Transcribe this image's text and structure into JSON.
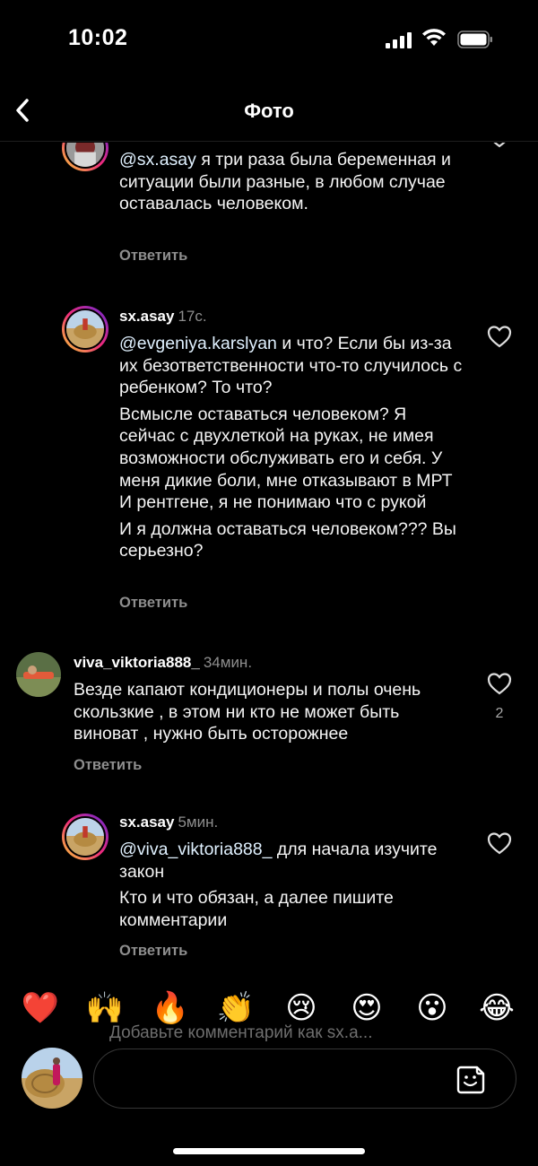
{
  "status_bar": {
    "time": "10:02"
  },
  "nav": {
    "title": "Фото",
    "back_icon": "chevron-left-icon"
  },
  "comments": [
    {
      "user": "",
      "time": "",
      "mention": "@sx.asay",
      "paragraphs": [
        "я три раза была беременная и ситуации были разные, в любом случае оставалась человеком."
      ],
      "reply_label": "Ответить",
      "likes": ""
    },
    {
      "user": "sx.asay",
      "time": "17с.",
      "mention": "@evgeniya.karslyan",
      "paragraphs": [
        "и что? Если бы из-за их безответственности что-то случилось с ребенком? То что?",
        "Всмысле оставаться человеком? Я сейчас с двухлеткой на руках, не имея возможности обслуживать его и себя. У меня дикие боли, мне отказывают в МРТ И рентгене, я не понимаю что с рукой",
        "И я должна оставаться человеком??? Вы серьезно?"
      ],
      "reply_label": "Ответить",
      "likes": ""
    },
    {
      "user": "viva_viktoria888_",
      "time": "34мин.",
      "mention": "",
      "paragraphs": [
        "Везде капают кондиционеры и полы очень скользкие , в этом ни кто не может быть виноват , нужно быть осторожнее"
      ],
      "reply_label": "Ответить",
      "likes": "2"
    },
    {
      "user": "sx.asay",
      "time": "5мин.",
      "mention": "@viva_viktoria888_",
      "paragraphs": [
        "для начала изучите закон",
        "Кто и что обязан, а далее пишите комментарии"
      ],
      "reply_label": "Ответить",
      "likes": ""
    }
  ],
  "reactions": [
    "❤️",
    "🙌",
    "🔥",
    "👏",
    "😢",
    "😍",
    "😮",
    "😂"
  ],
  "composer": {
    "placeholder": "Добавьте комментарий как sx.a..."
  },
  "colors": {
    "background": "#000000",
    "secondary_text": "#8e8e8e",
    "mention": "#e0f1ff"
  }
}
